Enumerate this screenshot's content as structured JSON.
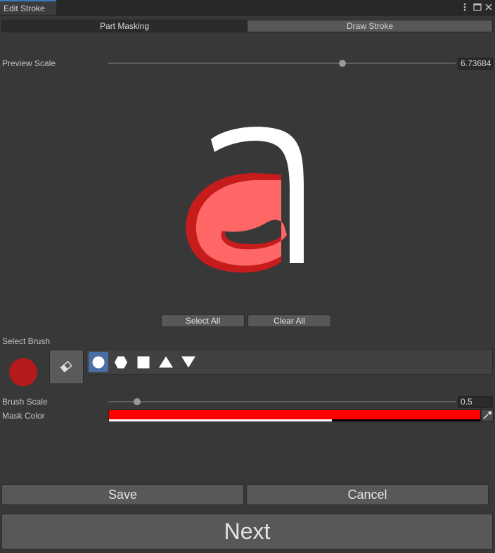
{
  "window": {
    "tab_title": "Edit Stroke",
    "controls": {
      "menu_icon": "kebab-menu-icon",
      "maximize_icon": "maximize-icon",
      "close_icon": "close-icon"
    }
  },
  "toolbar": {
    "tabs": [
      {
        "label": "Part Masking",
        "active": true
      },
      {
        "label": "Draw Stroke",
        "active": false
      }
    ]
  },
  "preview_scale": {
    "label": "Preview Scale",
    "value": "6.73684",
    "min": 0,
    "max": 10,
    "level": 6.73684
  },
  "preview": {
    "glyph": "a",
    "colors": {
      "stroke": "#ffffff",
      "mask_fill": "#ff6666",
      "mask_edge": "#c61c1c"
    }
  },
  "selection": {
    "select_all": "Select All",
    "clear_all": "Clear All"
  },
  "brush": {
    "label": "Select Brush",
    "current_color": "#b41a1a",
    "eraser_icon": "eraser-icon",
    "shapes": [
      {
        "icon": "circle-brush-icon",
        "selected": true
      },
      {
        "icon": "hexagon-brush-icon",
        "selected": false
      },
      {
        "icon": "square-brush-icon",
        "selected": false
      },
      {
        "icon": "triangle-up-brush-icon",
        "selected": false
      },
      {
        "icon": "triangle-down-brush-icon",
        "selected": false
      }
    ],
    "scale": {
      "label": "Brush Scale",
      "value": "0.5",
      "min": 0,
      "max": 6,
      "level": 0.5
    }
  },
  "mask_color": {
    "label": "Mask Color",
    "color": "#ff0000",
    "alpha_fraction": 0.6,
    "picker_icon": "eyedropper-icon"
  },
  "actions": {
    "save": "Save",
    "cancel": "Cancel",
    "next": "Next"
  }
}
